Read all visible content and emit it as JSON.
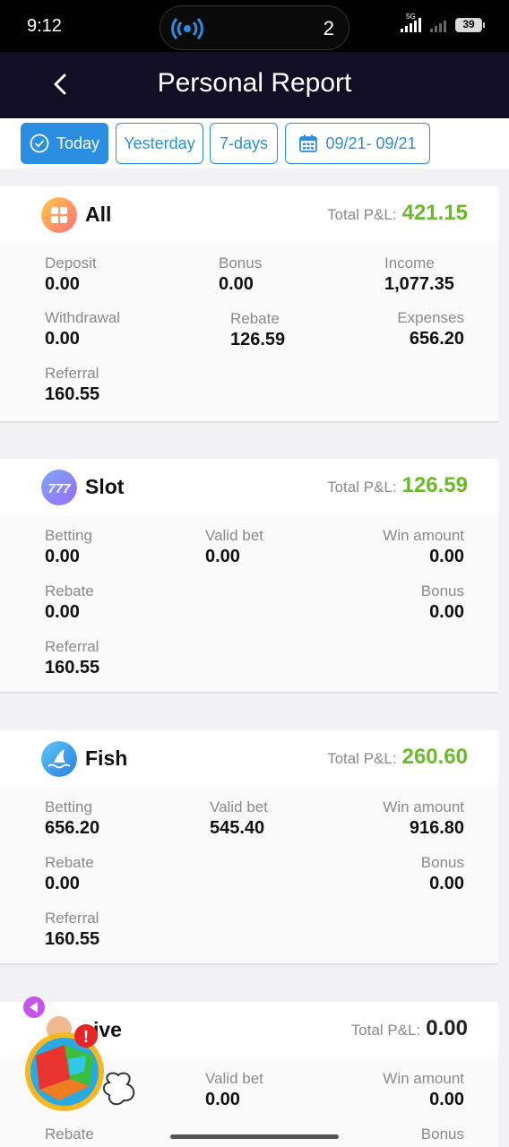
{
  "status_bar": {
    "time": "9:12",
    "island_count": "2",
    "network": "5G",
    "battery": "39"
  },
  "header": {
    "title": "Personal Report"
  },
  "filters": {
    "today": "Today",
    "yesterday": "Yesterday",
    "seven_days": "7-days",
    "date_range": "09/21- 09/21",
    "active": "today"
  },
  "pl_label": "Total P&L:",
  "sections": {
    "all": {
      "name": "All",
      "total_pl": "421.15",
      "deposit": {
        "label": "Deposit",
        "value": "0.00"
      },
      "bonus": {
        "label": "Bonus",
        "value": "0.00"
      },
      "income": {
        "label": "Income",
        "value": "1,077.35"
      },
      "withdrawal": {
        "label": "Withdrawal",
        "value": "0.00"
      },
      "rebate": {
        "label": "Rebate",
        "value": "126.59"
      },
      "expenses": {
        "label": "Expenses",
        "value": "656.20"
      },
      "referral": {
        "label": "Referral",
        "value": "160.55"
      }
    },
    "slot": {
      "name": "Slot",
      "total_pl": "126.59",
      "betting": {
        "label": "Betting",
        "value": "0.00"
      },
      "valid_bet": {
        "label": "Valid bet",
        "value": "0.00"
      },
      "win_amount": {
        "label": "Win amount",
        "value": "0.00"
      },
      "rebate": {
        "label": "Rebate",
        "value": "0.00"
      },
      "bonus": {
        "label": "Bonus",
        "value": "0.00"
      },
      "referral": {
        "label": "Referral",
        "value": "160.55"
      }
    },
    "fish": {
      "name": "Fish",
      "total_pl": "260.60",
      "betting": {
        "label": "Betting",
        "value": "656.20"
      },
      "valid_bet": {
        "label": "Valid bet",
        "value": "545.40"
      },
      "win_amount": {
        "label": "Win amount",
        "value": "916.80"
      },
      "rebate": {
        "label": "Rebate",
        "value": "0.00"
      },
      "bonus": {
        "label": "Bonus",
        "value": "0.00"
      },
      "referral": {
        "label": "Referral",
        "value": "160.55"
      }
    },
    "live": {
      "name": "ive",
      "total_pl": "0.00",
      "valid_bet": {
        "label": "Valid bet",
        "value": "0.00"
      },
      "win_amount": {
        "label": "Win amount",
        "value": "0.00"
      },
      "rebate": {
        "label": "Rebate"
      },
      "bonus": {
        "label": "Bonus"
      }
    }
  },
  "floating_widget": {
    "badge": "!"
  },
  "colors": {
    "header_bg": "#120e26",
    "accent_blue": "#2b8ee0",
    "profit_green": "#6cb92c"
  },
  "icons": {
    "back": "chevron-left-icon",
    "calendar": "calendar-icon",
    "check": "check-circle-icon"
  }
}
